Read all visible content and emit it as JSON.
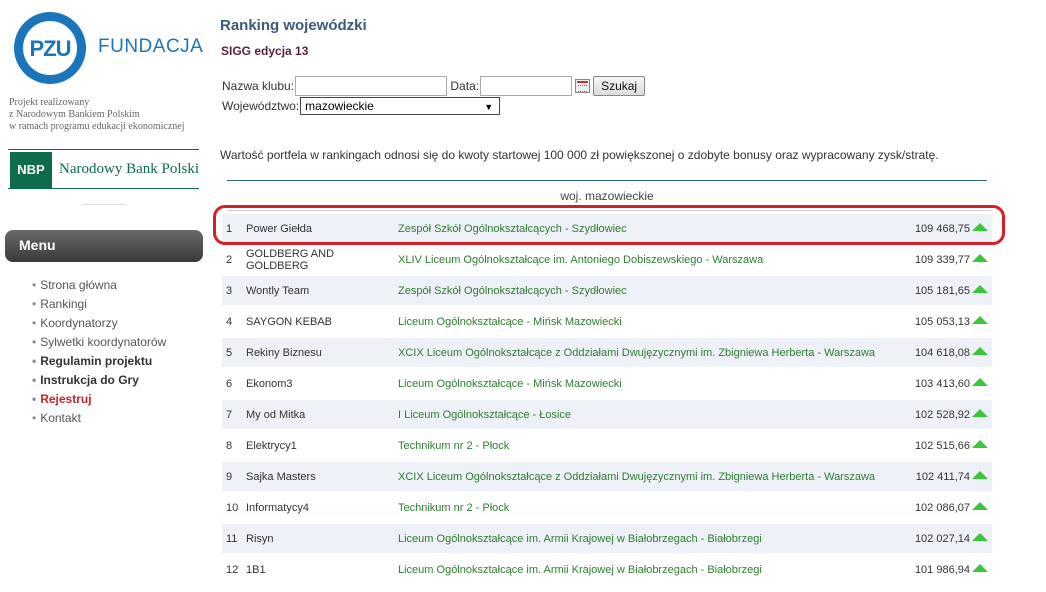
{
  "sidebar": {
    "logo_text": "PZU",
    "foundation": "FUNDACJA",
    "project_lines": [
      "Projekt realizowany",
      "z Narodowym Bankiem Polskim",
      "w ramach programu edukacji ekonomicznej"
    ],
    "nbp_abbr": "NBP",
    "nbp_name": "Narodowy Bank Polski",
    "menu_title": "Menu",
    "menu_items": [
      {
        "label": "Strona główna"
      },
      {
        "label": "Rankingi"
      },
      {
        "label": "Koordynatorzy"
      },
      {
        "label": "Sylwetki koordynatorów"
      },
      {
        "label": "Regulamin projektu"
      },
      {
        "label": "Instrukcja do Gry"
      },
      {
        "label": "Rejestruj"
      },
      {
        "label": "Kontakt"
      }
    ]
  },
  "main": {
    "title": "Ranking wojewódzki",
    "edition": "SIGG edycja 13",
    "form": {
      "club_label": "Nazwa klubu:",
      "club_value": "",
      "date_label": "Data:",
      "date_value": "",
      "search_button": "Szukaj",
      "voivodeship_label": "Województwo:",
      "voivodeship_value": "mazowieckie"
    },
    "info": "Wartość portfela w rankingach odnosi się do kwoty startowej 100 000 zł powiększonej o zdobyte bonusy oraz wypracowany zysk/stratę.",
    "region_header": "woj. mazowieckie",
    "colors": {
      "trend_up": "#3cc63c",
      "school_link": "#2e7d32",
      "highlight": "#d81e24"
    },
    "rows": [
      {
        "rank": "1",
        "club": "Power Giełda",
        "school": "Zespół Szkół Ogólnokształcących - Szydłowiec",
        "value": "109 468,75",
        "trend": "up-arrow-icon"
      },
      {
        "rank": "2",
        "club": "GOLDBERG AND GOLDBERG",
        "school": "XLIV Liceum Ogólnokształcące im. Antoniego Dobiszewskiego - Warszawa",
        "value": "109 339,77",
        "trend": "up-arrow-icon"
      },
      {
        "rank": "3",
        "club": "Wontly Team",
        "school": "Zespół Szkół Ogólnokształcących - Szydłowiec",
        "value": "105 181,65",
        "trend": "up-arrow-icon"
      },
      {
        "rank": "4",
        "club": "SAYGON KEBAB",
        "school": "Liceum Ogólnokształcące - Mińsk Mazowiecki",
        "value": "105 053,13",
        "trend": "up-arrow-icon"
      },
      {
        "rank": "5",
        "club": "Rekiny Biznesu",
        "school": "XCIX Liceum Ogólnokształcące z Oddziałami Dwujęzycznymi im. Zbigniewa Herberta - Warszawa",
        "value": "104 618,08",
        "trend": "up-arrow-icon"
      },
      {
        "rank": "6",
        "club": "Ekonom3",
        "school": "Liceum Ogólnokształcące - Mińsk Mazowiecki",
        "value": "103 413,60",
        "trend": "up-arrow-icon"
      },
      {
        "rank": "7",
        "club": "My od Mitka",
        "school": "I Liceum Ogólnokształcące - Łosice",
        "value": "102 528,92",
        "trend": "up-arrow-icon"
      },
      {
        "rank": "8",
        "club": "Elektrycy1",
        "school": "Technikum nr 2 - Płock",
        "value": "102 515,66",
        "trend": "up-arrow-icon"
      },
      {
        "rank": "9",
        "club": "Sajka Masters",
        "school": "XCIX Liceum Ogólnokształcące z Oddziałami Dwujęzycznymi im. Zbigniewa Herberta - Warszawa",
        "value": "102 411,74",
        "trend": "up-arrow-icon"
      },
      {
        "rank": "10",
        "club": "Informatycy4",
        "school": "Technikum nr 2 - Płock",
        "value": "102 086,07",
        "trend": "up-arrow-icon"
      },
      {
        "rank": "11",
        "club": "Risyn",
        "school": "Liceum Ogólnokształcące im. Armii Krajowej w Białobrzegach - Białobrzegi",
        "value": "102 027,14",
        "trend": "up-arrow-icon"
      },
      {
        "rank": "12",
        "club": "1B1",
        "school": "Liceum Ogólnokształcące im. Armii Krajowej w Białobrzegach - Białobrzegi",
        "value": "101 986,94",
        "trend": "up-arrow-icon"
      }
    ]
  }
}
